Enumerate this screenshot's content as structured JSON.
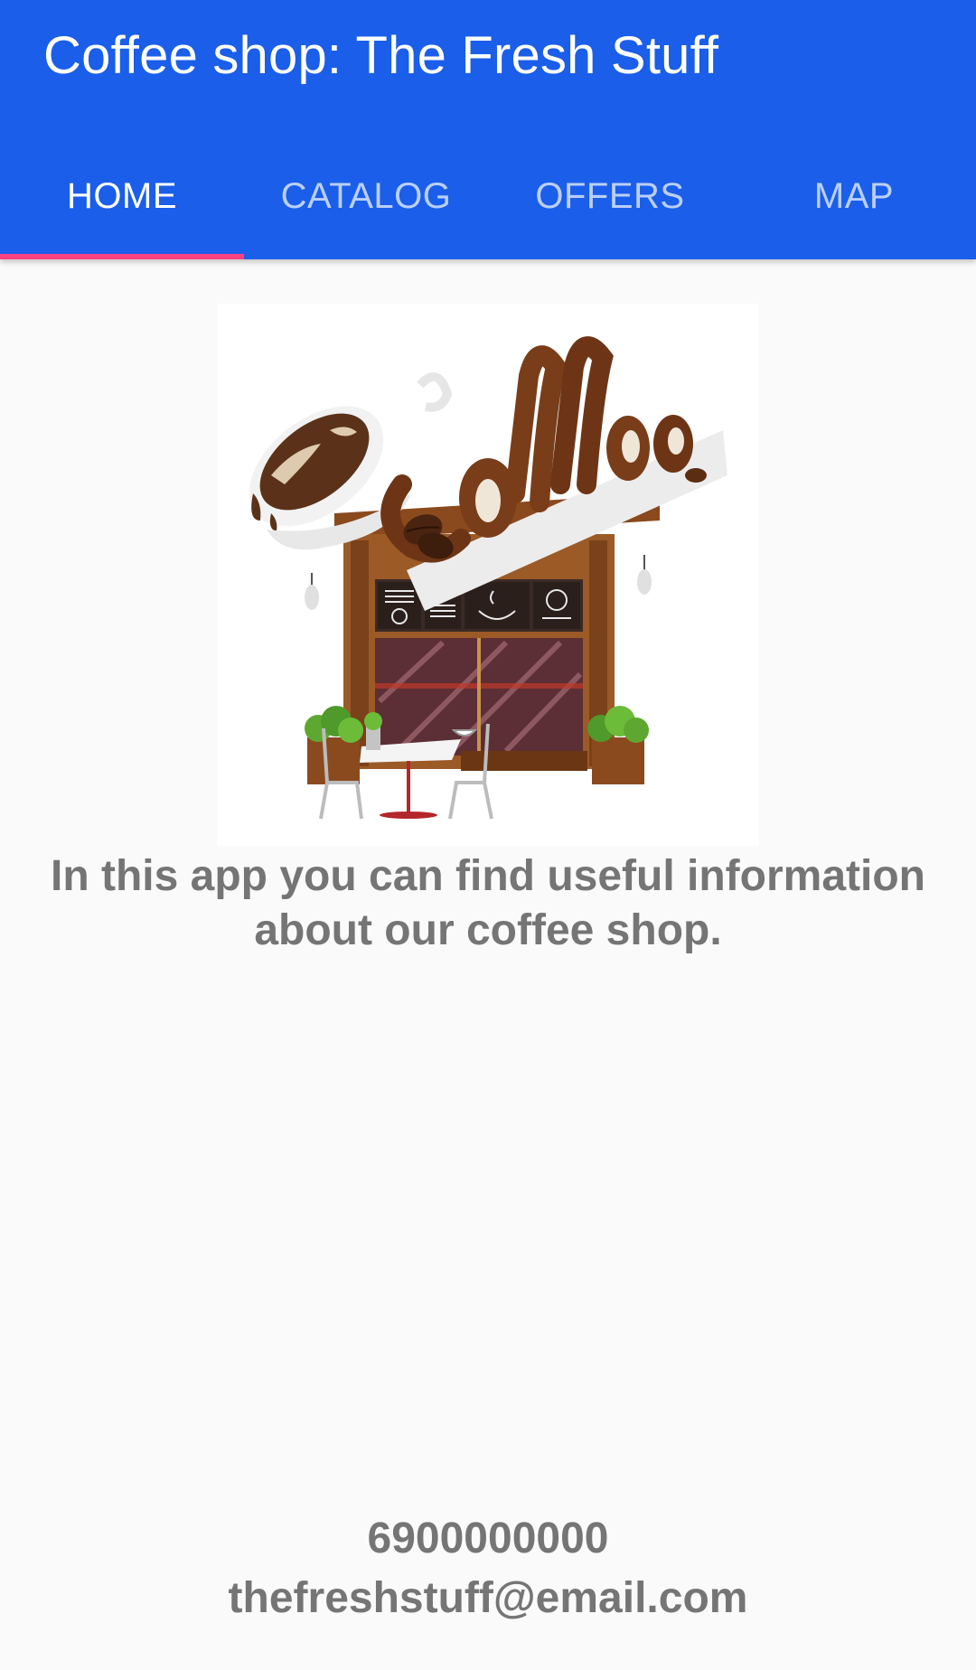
{
  "app_bar": {
    "title": "Coffee shop: The Fresh Stuff",
    "background_color": "#1a5eea"
  },
  "tabs": [
    {
      "label": "HOME",
      "selected": true
    },
    {
      "label": "CATALOG",
      "selected": false
    },
    {
      "label": "OFFERS",
      "selected": false
    },
    {
      "label": "MAP",
      "selected": false
    }
  ],
  "tab_indicator_color": "#ff4081",
  "hero_image": {
    "logo_text": "Coffee",
    "description": "coffee-shop-illustration"
  },
  "intro_text": "In this app you can find useful information about our coffee shop.",
  "contact": {
    "phone": "6900000000",
    "email": "thefreshstuff@email.com"
  }
}
